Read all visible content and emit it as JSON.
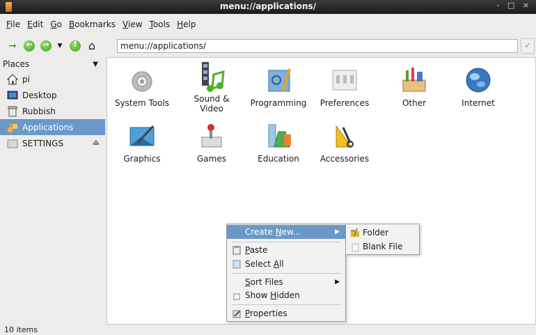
{
  "window": {
    "title": "menu://applications/",
    "controls": "- □ ×"
  },
  "menubar": [
    {
      "pre": "",
      "u": "F",
      "post": "ile"
    },
    {
      "pre": "",
      "u": "E",
      "post": "dit"
    },
    {
      "pre": "",
      "u": "G",
      "post": "o"
    },
    {
      "pre": "",
      "u": "B",
      "post": "ookmarks"
    },
    {
      "pre": "",
      "u": "V",
      "post": "iew"
    },
    {
      "pre": "",
      "u": "T",
      "post": "ools"
    },
    {
      "pre": "",
      "u": "H",
      "post": "elp"
    }
  ],
  "toolbar": {
    "location": "menu://applications/"
  },
  "sidebar": {
    "header": "Places",
    "items": [
      {
        "label": "pi",
        "icon": "home-icon"
      },
      {
        "label": "Desktop",
        "icon": "desktop-icon"
      },
      {
        "label": "Rubbish",
        "icon": "trash-icon"
      },
      {
        "label": "Applications",
        "icon": "applications-icon",
        "selected": true
      },
      {
        "label": "SETTINGS",
        "icon": "drive-icon"
      }
    ]
  },
  "apps": [
    {
      "label": "System Tools",
      "icon": "system-tools-icon"
    },
    {
      "label": "Sound &\nVideo",
      "icon": "sound-video-icon"
    },
    {
      "label": "Programming",
      "icon": "programming-icon"
    },
    {
      "label": "Preferences",
      "icon": "preferences-icon"
    },
    {
      "label": "Other",
      "icon": "other-icon"
    },
    {
      "label": "Internet",
      "icon": "internet-icon"
    },
    {
      "label": "Graphics",
      "icon": "graphics-icon"
    },
    {
      "label": "Games",
      "icon": "games-icon"
    },
    {
      "label": "Education",
      "icon": "education-icon"
    },
    {
      "label": "Accessories",
      "icon": "accessories-icon"
    }
  ],
  "status": "10 items",
  "context_menu": {
    "create_new": {
      "pre": "Create ",
      "u": "N",
      "post": "ew..."
    },
    "paste": {
      "pre": "",
      "u": "P",
      "post": "aste"
    },
    "select_all": {
      "pre": "Select ",
      "u": "A",
      "post": "ll"
    },
    "sort_files": {
      "pre": "",
      "u": "S",
      "post": "ort Files"
    },
    "show_hidden": {
      "pre": "Show ",
      "u": "H",
      "post": "idden"
    },
    "properties": {
      "pre": "",
      "u": "P",
      "post": "roperties"
    }
  },
  "submenu": {
    "folder": "Folder",
    "blank_file": "Blank File"
  },
  "colors": {
    "selection": "#6a98c9",
    "accent_green": "#3c9a1c"
  }
}
